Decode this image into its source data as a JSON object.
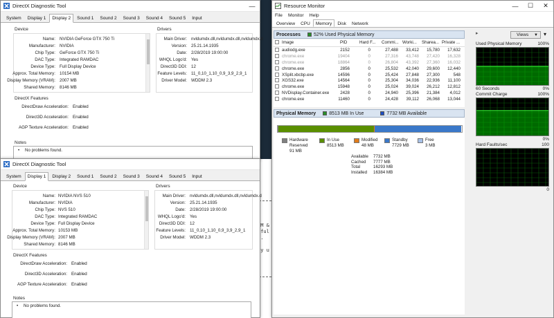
{
  "colors": {
    "desktop": "#1b2a38",
    "rm_header": "#d9e4f1",
    "hw_reserved": "#808080",
    "in_use": "#5a8f00",
    "modified": "#e07b1a",
    "standby": "#3a78c9",
    "free": "#a8c1e8",
    "graph_green": "#00c000"
  },
  "console": {
    "lines": [
      "AM &",
      "sful",
      "S.",
      "dy u"
    ]
  },
  "dx1": {
    "title": "DirectX Diagnostic Tool",
    "tabs": [
      "System",
      "Display 1",
      "Display 2",
      "Sound 1",
      "Sound 2",
      "Sound 3",
      "Sound 4",
      "Sound 5",
      "Input"
    ],
    "active_tab": "Display 2",
    "device_title": "Device",
    "drivers_title": "Drivers",
    "device": [
      {
        "k": "Name:",
        "v": "NVIDIA GeForce GTX 750 Ti"
      },
      {
        "k": "Manufacturer:",
        "v": "NVIDIA"
      },
      {
        "k": "Chip Type:",
        "v": "GeForce GTX 750 Ti"
      },
      {
        "k": "DAC Type:",
        "v": "Integrated RAMDAC"
      },
      {
        "k": "Device Type:",
        "v": "Full Display Device"
      },
      {
        "k": "Approx. Total Memory:",
        "v": "10154 MB"
      },
      {
        "k": "Display Memory (VRAM):",
        "v": "2007 MB"
      },
      {
        "k": "Shared Memory:",
        "v": "8146 MB"
      }
    ],
    "drivers": [
      {
        "k": "Main Driver:",
        "v": "nvldumdx.dll,nvldumdx.dll,nvldumdx.d"
      },
      {
        "k": "Version:",
        "v": "25.21.14.1935"
      },
      {
        "k": "Date:",
        "v": "2/28/2019 19:00:00"
      },
      {
        "k": "WHQL Logo'd:",
        "v": "Yes"
      },
      {
        "k": "Direct3D DDI:",
        "v": "12"
      },
      {
        "k": "Feature Levels:",
        "v": "11_0,10_1,10_0,9_3,9_2,9_1"
      },
      {
        "k": "Driver Model:",
        "v": "WDDM 2.3"
      }
    ],
    "features_title": "DirectX Features",
    "features": [
      {
        "k": "DirectDraw Acceleration:",
        "v": "Enabled"
      },
      {
        "k": "Direct3D Acceleration:",
        "v": "Enabled"
      },
      {
        "k": "AGP Texture Acceleration:",
        "v": "Enabled"
      }
    ],
    "notes_title": "Notes",
    "notes": "No problems found."
  },
  "dx2": {
    "title": "DirectX Diagnostic Tool",
    "tabs": [
      "System",
      "Display 1",
      "Display 2",
      "Sound 1",
      "Sound 2",
      "Sound 3",
      "Sound 4",
      "Sound 5",
      "Input"
    ],
    "active_tab": "Display 1",
    "device_title": "Device",
    "drivers_title": "Drivers",
    "device": [
      {
        "k": "Name:",
        "v": "NVIDIA NVS 510"
      },
      {
        "k": "Manufacturer:",
        "v": "NVIDIA"
      },
      {
        "k": "Chip Type:",
        "v": "NVS 510"
      },
      {
        "k": "DAC Type:",
        "v": "Integrated RAMDAC"
      },
      {
        "k": "Device Type:",
        "v": "Full Display Device"
      },
      {
        "k": "Approx. Total Memory:",
        "v": "10153 MB"
      },
      {
        "k": "Display Memory (VRAM):",
        "v": "2007 MB"
      },
      {
        "k": "Shared Memory:",
        "v": "8146 MB"
      }
    ],
    "drivers": [
      {
        "k": "Main Driver:",
        "v": "nvldumdx.dll,nvldumdx.dll,nvldumdx.d"
      },
      {
        "k": "Version:",
        "v": "25.21.14.1935"
      },
      {
        "k": "Date:",
        "v": "2/28/2019 19:00:00"
      },
      {
        "k": "WHQL Logo'd:",
        "v": "Yes"
      },
      {
        "k": "Direct3D DDI:",
        "v": "12"
      },
      {
        "k": "Feature Levels:",
        "v": "11_0,10_1,10_0,9_3,9_2,9_1"
      },
      {
        "k": "Driver Model:",
        "v": "WDDM 2.3"
      }
    ],
    "features_title": "DirectX Features",
    "features": [
      {
        "k": "DirectDraw Acceleration:",
        "v": "Enabled"
      },
      {
        "k": "Direct3D Acceleration:",
        "v": "Enabled"
      },
      {
        "k": "AGP Texture Acceleration:",
        "v": "Enabled"
      }
    ],
    "notes_title": "Notes",
    "notes": "No problems found."
  },
  "rm": {
    "title": "Resource Monitor",
    "menu": [
      "File",
      "Monitor",
      "Help"
    ],
    "tabs": [
      "Overview",
      "CPU",
      "Memory",
      "Disk",
      "Network"
    ],
    "active_tab": "Memory",
    "processes": {
      "title": "Processes",
      "summary": "52% Used Physical Memory",
      "columns": [
        "Image",
        "PID",
        "Hard F...",
        "Commi...",
        "Worki...",
        "Sharea...",
        "Private ..."
      ],
      "rows": [
        {
          "image": "audiodg.exe",
          "pid": "2152",
          "hard": "0",
          "commit": "27,488",
          "working": "33,412",
          "shareable": "15,780",
          "private": "17,632",
          "dim": false
        },
        {
          "image": "chrome.exe",
          "pid": "19404",
          "hard": "0",
          "commit": "27,316",
          "working": "43,748",
          "shareable": "27,420",
          "private": "16,328",
          "dim": true
        },
        {
          "image": "chrome.exe",
          "pid": "18864",
          "hard": "0",
          "commit": "26,804",
          "working": "43,392",
          "shareable": "27,360",
          "private": "16,032",
          "dim": true
        },
        {
          "image": "chrome.exe",
          "pid": "2856",
          "hard": "0",
          "commit": "25,532",
          "working": "42,040",
          "shareable": "29,600",
          "private": "12,440",
          "dim": false
        },
        {
          "image": "XSplit.xbcbp.exe",
          "pid": "14596",
          "hard": "0",
          "commit": "25,424",
          "working": "27,848",
          "shareable": "27,300",
          "private": "548",
          "dim": false
        },
        {
          "image": "XGS32.exe",
          "pid": "14564",
          "hard": "0",
          "commit": "25,304",
          "working": "34,036",
          "shareable": "22,936",
          "private": "11,100",
          "dim": false
        },
        {
          "image": "chrome.exe",
          "pid": "15948",
          "hard": "0",
          "commit": "25,024",
          "working": "39,024",
          "shareable": "26,212",
          "private": "12,812",
          "dim": false
        },
        {
          "image": "NVDisplay.Container.exe",
          "pid": "2428",
          "hard": "0",
          "commit": "24,940",
          "working": "25,396",
          "shareable": "21,384",
          "private": "4,012",
          "dim": false
        },
        {
          "image": "chrome.exe",
          "pid": "11460",
          "hard": "0",
          "commit": "24,428",
          "working": "39,112",
          "shareable": "26,068",
          "private": "13,044",
          "dim": false
        }
      ]
    },
    "physical": {
      "title": "Physical Memory",
      "in_use_label": "8513 MB In Use",
      "available_label": "7732 MB Available",
      "legend": [
        {
          "name": "Hardware Reserved",
          "value": "91 MB",
          "color": "#808080"
        },
        {
          "name": "In Use",
          "value": "8513 MB",
          "color": "#5a8f00"
        },
        {
          "name": "Modified",
          "value": "48 MB",
          "color": "#e07b1a"
        },
        {
          "name": "Standby",
          "value": "7729 MB",
          "color": "#3a78c9"
        },
        {
          "name": "Free",
          "value": "3 MB",
          "color": "#a8c1e8"
        }
      ],
      "bar_fractions": [
        0.0055,
        0.5171,
        0.0029,
        0.4695,
        0.0002
      ],
      "stats": [
        {
          "k": "Available",
          "v": "7732 MB"
        },
        {
          "k": "Cached",
          "v": "7777 MB"
        },
        {
          "k": "Total",
          "v": "16293 MB"
        },
        {
          "k": "Installed",
          "v": "16384 MB"
        }
      ]
    },
    "graphs": {
      "views_label": "Views",
      "used_physical": {
        "label": "Used Physical Memory",
        "max": "100%",
        "min": "0%",
        "footer": "60 Seconds",
        "level": 0.52
      },
      "commit_charge": {
        "label": "Commit Charge",
        "max": "100%",
        "min": "0%",
        "level": 0.68
      },
      "hard_faults": {
        "label": "Hard Faults/sec",
        "max": "100",
        "min": "0",
        "level": 0.0
      }
    }
  }
}
